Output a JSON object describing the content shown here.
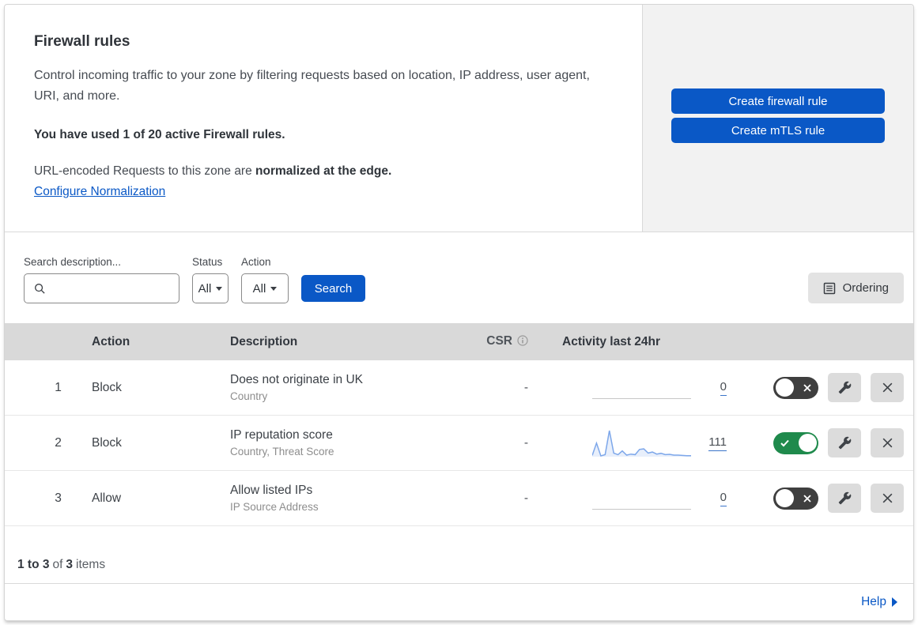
{
  "header": {
    "title": "Firewall rules",
    "description": "Control incoming traffic to your zone by filtering requests based on location, IP address, user agent, URI, and more.",
    "usage": "You have used 1 of 20 active Firewall rules.",
    "normalization_text": "URL-encoded Requests to this zone are ",
    "normalization_bold": "normalized at the edge.",
    "normalization_link": "Configure Normalization"
  },
  "actions_panel": {
    "create_firewall_rule_label": "Create firewall rule",
    "create_mtls_rule_label": "Create mTLS rule"
  },
  "filters": {
    "search_label": "Search description...",
    "search_value": "",
    "status_label": "Status",
    "status_value": "All",
    "action_label": "Action",
    "action_value": "All",
    "search_button_label": "Search",
    "ordering_button_label": "Ordering"
  },
  "table": {
    "headers": {
      "action": "Action",
      "description": "Description",
      "csr": "CSR",
      "activity": "Activity last 24hr"
    },
    "rules": [
      {
        "number": "1",
        "action": "Block",
        "description": "Does not originate in UK",
        "criteria": "Country",
        "csr": "-",
        "activity_count": "0",
        "enabled": false,
        "activity_values": []
      },
      {
        "number": "2",
        "action": "Block",
        "description": "IP reputation score",
        "criteria": "Country, Threat Score",
        "csr": "-",
        "activity_count": "111",
        "enabled": true,
        "activity_values": [
          5,
          52,
          3,
          8,
          100,
          14,
          8,
          22,
          6,
          10,
          8,
          28,
          30,
          14,
          18,
          10,
          13,
          8,
          9,
          6,
          6,
          5,
          4,
          4
        ]
      },
      {
        "number": "3",
        "action": "Allow",
        "description": "Allow listed IPs",
        "criteria": "IP Source Address",
        "csr": "-",
        "activity_count": "0",
        "enabled": false,
        "activity_values": []
      }
    ],
    "footer": {
      "range": "1 to 3",
      "of_text": "of",
      "total": "3",
      "items_text": "items"
    }
  },
  "help": {
    "label": "Help"
  },
  "colors": {
    "accent_blue": "#0a58c6",
    "toggle_on_green": "#1f8a4c",
    "toggle_off_dark": "#3f3f3f",
    "sparkline_blue": "#7da7ea",
    "header_gray": "#d9d9d9",
    "panel_gray": "#f2f2f2"
  }
}
